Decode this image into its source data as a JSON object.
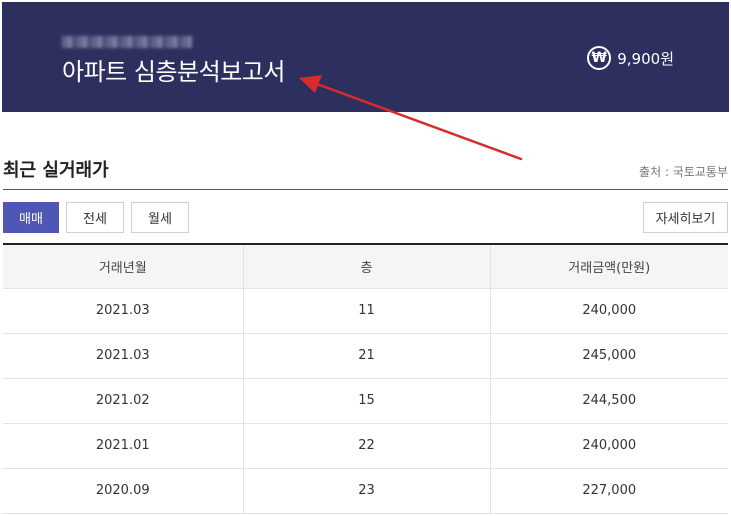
{
  "banner": {
    "title": "아파트 심층분석보고서",
    "price_symbol": "₩",
    "price": "9,900원",
    "background": "#2d2f5e"
  },
  "section": {
    "title": "최근 실거래가",
    "source": "출처 : 국토교통부"
  },
  "tabs": [
    {
      "label": "매매",
      "active": true
    },
    {
      "label": "전세",
      "active": false
    },
    {
      "label": "월세",
      "active": false
    }
  ],
  "detail_button": "자세히보기",
  "table": {
    "headers": [
      "거래년월",
      "층",
      "거래금액(만원)"
    ],
    "rows": [
      [
        "2021.03",
        "11",
        "240,000"
      ],
      [
        "2021.03",
        "21",
        "245,000"
      ],
      [
        "2021.02",
        "15",
        "244,500"
      ],
      [
        "2021.01",
        "22",
        "240,000"
      ],
      [
        "2020.09",
        "23",
        "227,000"
      ]
    ]
  },
  "colors": {
    "accent": "#4f56b4",
    "annotation_arrow": "#d92b2b"
  },
  "icons": {
    "price": "won-circle-icon",
    "annotation": "red-arrow-icon"
  }
}
